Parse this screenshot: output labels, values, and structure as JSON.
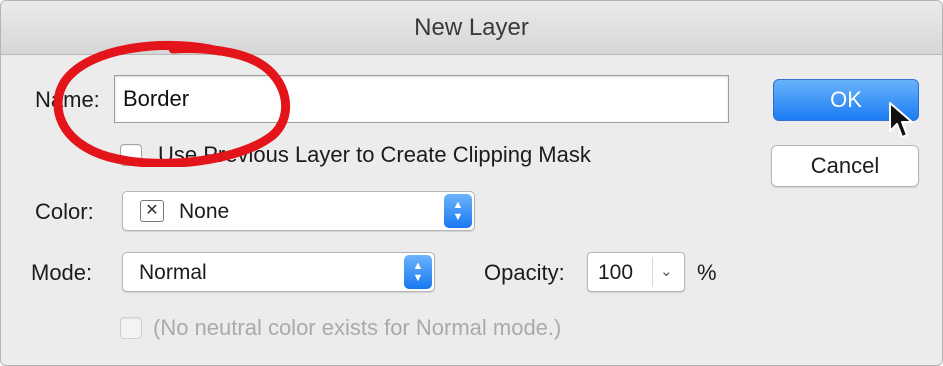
{
  "window": {
    "title": "New Layer"
  },
  "name_field": {
    "label": "Name:",
    "value": "Border"
  },
  "clipping_mask": {
    "label": "Use Previous Layer to Create Clipping Mask",
    "checked": false
  },
  "color": {
    "label": "Color:",
    "swatch_glyph": "✕",
    "value": "None"
  },
  "mode": {
    "label": "Mode:",
    "value": "Normal"
  },
  "opacity": {
    "label": "Opacity:",
    "value": "100",
    "unit": "%"
  },
  "neutral_color": {
    "label": "(No neutral color exists for Normal mode.)",
    "enabled": false
  },
  "buttons": {
    "ok": "OK",
    "cancel": "Cancel"
  },
  "colors": {
    "accent": "#1a7cf3",
    "annotation": "#e3151a",
    "window_bg": "#ececec"
  },
  "icons": {
    "stepper": "up-down-chevron-icon",
    "dropdown": "chevron-down-icon",
    "cursor": "arrow-cursor-icon"
  }
}
